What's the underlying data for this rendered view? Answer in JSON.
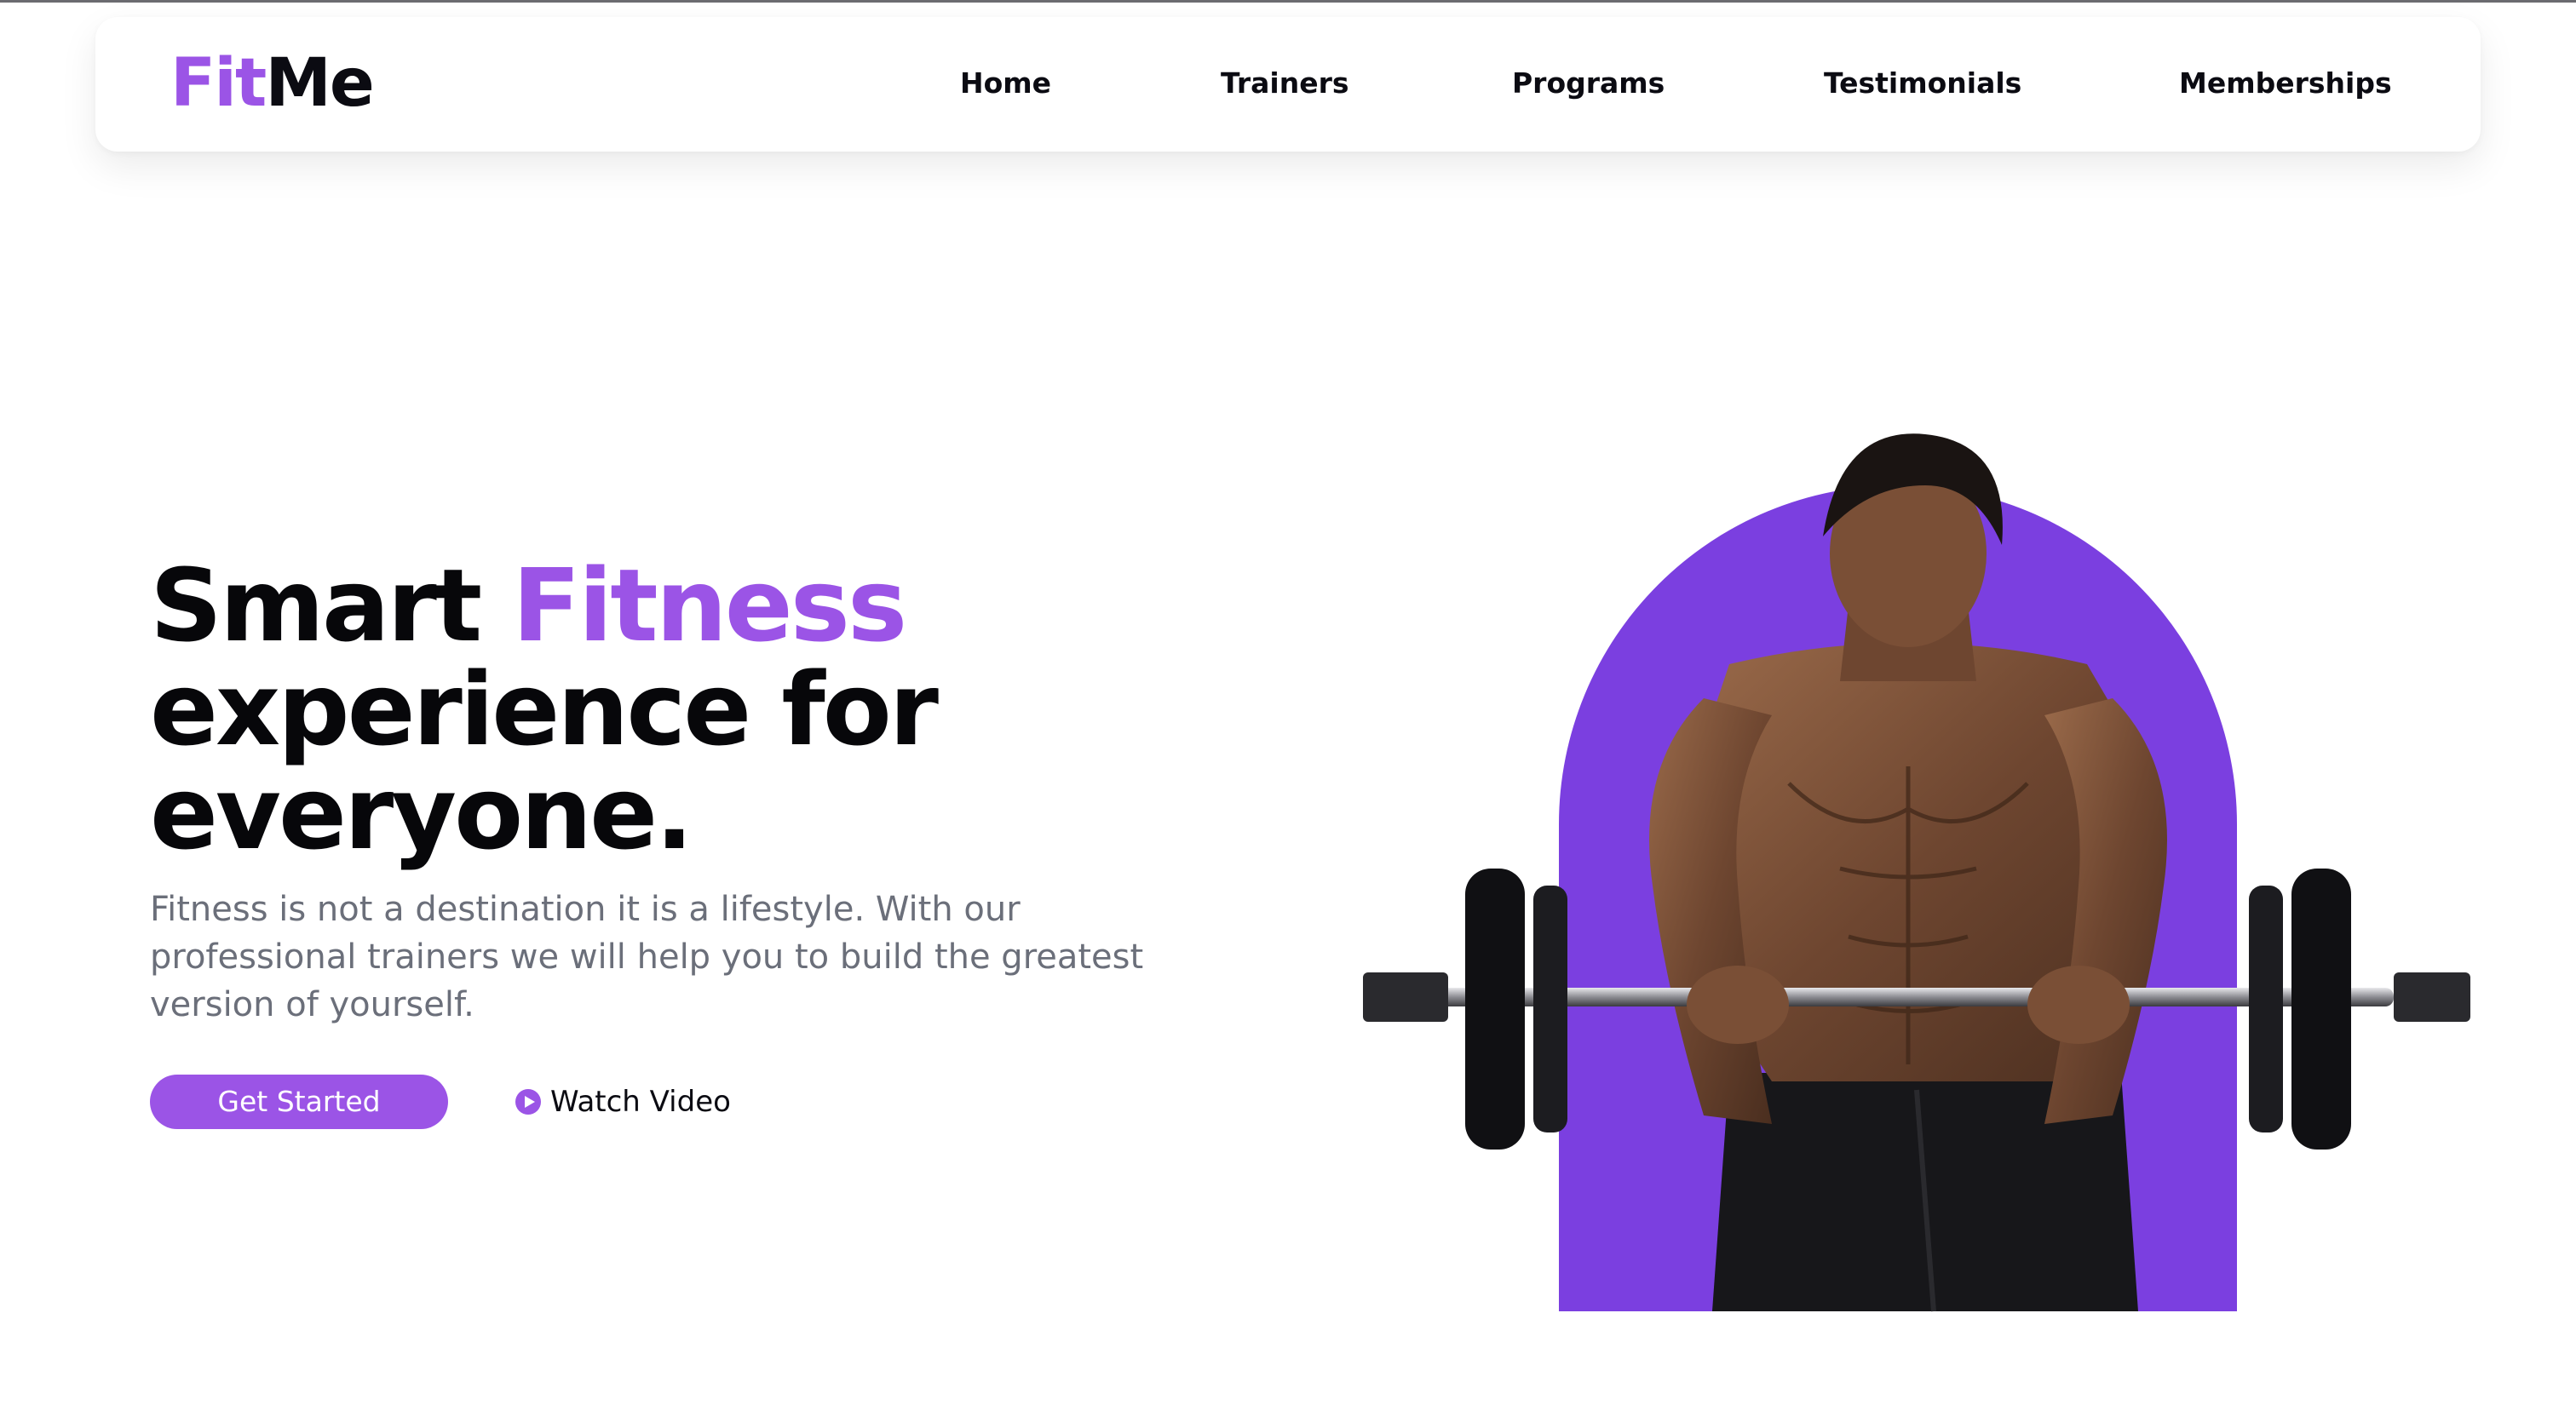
{
  "brand": {
    "logo_part1": "Fit",
    "logo_part2": "Me",
    "accent_color": "#9b54e6",
    "arch_color": "#7b3fe0"
  },
  "nav": {
    "items": [
      {
        "label": "Home"
      },
      {
        "label": "Trainers"
      },
      {
        "label": "Programs"
      },
      {
        "label": "Testimonials"
      },
      {
        "label": "Memberships"
      }
    ]
  },
  "hero": {
    "title_line1_a": "Smart ",
    "title_line1_b": "Fitness",
    "title_line2": "experience for",
    "title_line3": "everyone.",
    "description": "Fitness is not a destination it is a lifestyle. With our professional trainers we will help you to build the greatest version of yourself.",
    "cta_label": "Get Started",
    "watch_label": "Watch Video",
    "watch_icon": "play-circle-icon",
    "image_subject": "athlete-with-barbell"
  }
}
